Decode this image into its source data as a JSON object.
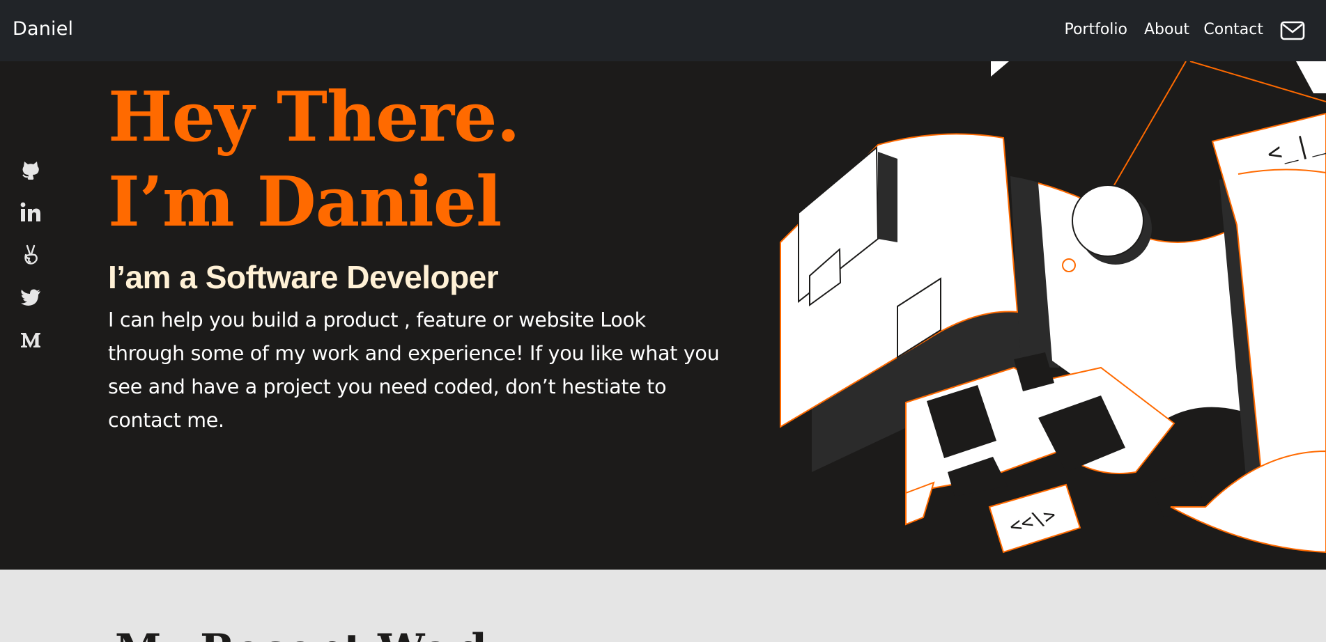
{
  "nav": {
    "brand": "Daniel",
    "links": [
      "Portfolio",
      "About",
      "Contact"
    ],
    "mail_icon": "mail-icon"
  },
  "social": [
    {
      "name": "github-icon"
    },
    {
      "name": "linkedin-icon"
    },
    {
      "name": "angellist-icon"
    },
    {
      "name": "twitter-icon"
    },
    {
      "name": "medium-icon"
    }
  ],
  "hero": {
    "headline_line1": "Hey There.",
    "headline_line2": "I’m Daniel",
    "subtitle": "I’am a Software Developer",
    "bio": "I can help you build a product , feature or website Look through some of my work and experience! If you like what you see and have a project you need coded, don’t hestiate to contact me.",
    "illustration_code_1": "<_|_",
    "illustration_code_2": "<<\\>"
  },
  "work": {
    "title": "My Recent Work"
  },
  "colors": {
    "accent": "#ff6a00",
    "navbar": "#212428",
    "hero_bg": "#1c1b1a",
    "subtitle": "#fff1d6",
    "section_bg": "#e5e5e5"
  }
}
